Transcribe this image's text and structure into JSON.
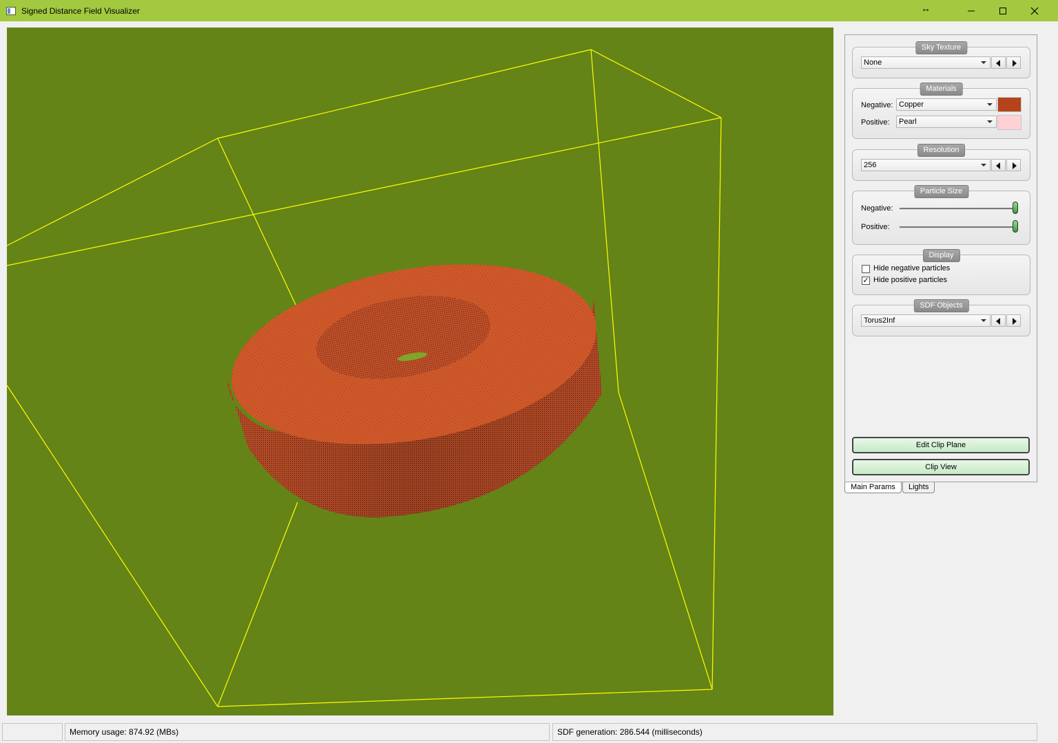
{
  "window": {
    "title": "Signed Distance Field Visualizer",
    "icons": [
      "app-icon",
      "resize-arrows-icon",
      "minimize-icon",
      "maximize-icon",
      "close-icon"
    ],
    "titlebar_color": "#a3c940"
  },
  "viewport": {
    "background_color": "#648417",
    "bounding_box_color": "#ffff00",
    "object_color": "#d4572a"
  },
  "panel": {
    "sky_texture": {
      "title": "Sky Texture",
      "value": "None"
    },
    "materials": {
      "title": "Materials",
      "negative_label": "Negative:",
      "negative_value": "Copper",
      "negative_color": "#b5431c",
      "positive_label": "Positive:",
      "positive_value": "Pearl",
      "positive_color": "#ffd0d4"
    },
    "resolution": {
      "title": "Resolution",
      "value": "256"
    },
    "particle_size": {
      "title": "Particle Size",
      "negative_label": "Negative:",
      "negative_level": 1.0,
      "positive_label": "Positive:",
      "positive_level": 1.0
    },
    "display": {
      "title": "Display",
      "hide_negative_label": "Hide negative particles",
      "hide_negative_checked": false,
      "hide_positive_label": "Hide positive particles",
      "hide_positive_checked": true
    },
    "sdf_objects": {
      "title": "SDF Objects",
      "value": "Torus2Inf"
    },
    "edit_clip_plane_label": "Edit Clip Plane",
    "clip_view_label": "Clip View",
    "tabs": [
      {
        "label": "Main Params",
        "active": true
      },
      {
        "label": "Lights",
        "active": false
      }
    ]
  },
  "status": {
    "cell0": "",
    "memory": "Memory usage: 874.92 (MBs)",
    "sdf_generation": "SDF generation: 286.544 (milliseconds)"
  }
}
